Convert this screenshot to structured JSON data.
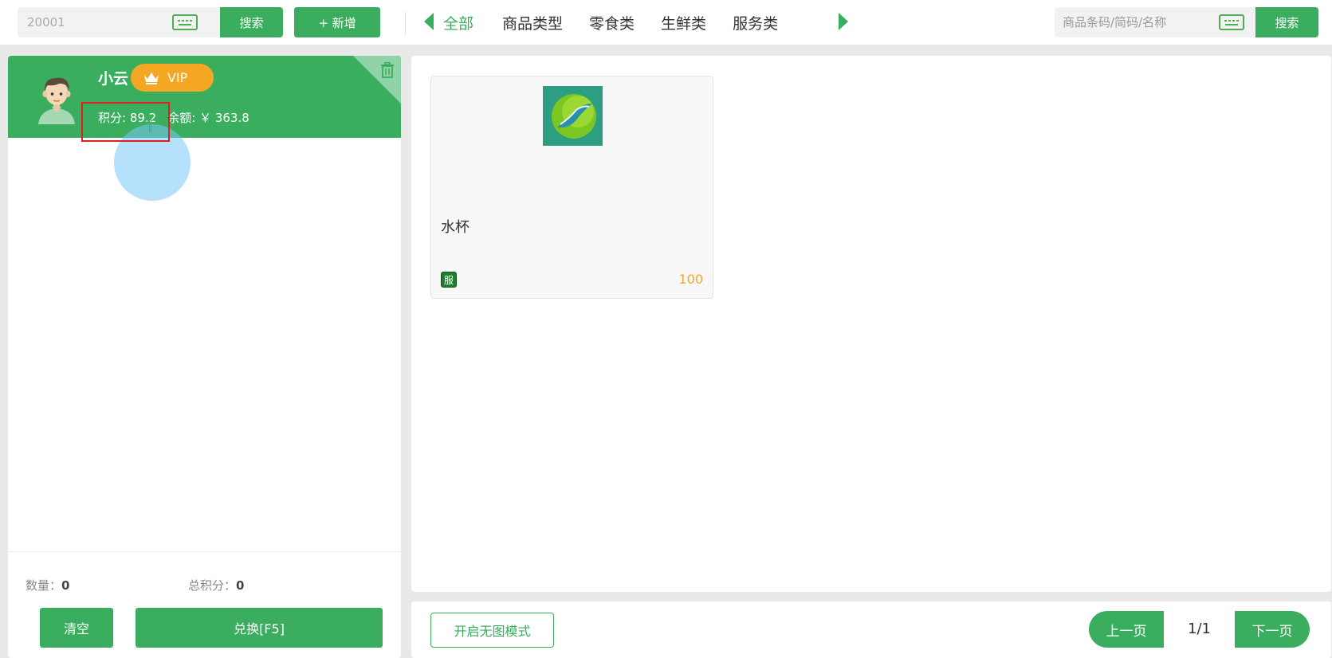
{
  "member_search": {
    "value": "20001",
    "button_label": "搜索"
  },
  "add_button_label": "+ 新增",
  "categories": [
    {
      "label": "全部",
      "active": true
    },
    {
      "label": "商品类型",
      "active": false
    },
    {
      "label": "零食类",
      "active": false
    },
    {
      "label": "生鲜类",
      "active": false
    },
    {
      "label": "服务类",
      "active": false
    }
  ],
  "goods_search": {
    "placeholder": "商品条码/简码/名称",
    "button_label": "搜索"
  },
  "member": {
    "name": "小云",
    "level": "VIP",
    "points_label": "积分: 89.2",
    "balance_label": "余额: ￥ 363.8"
  },
  "summary": {
    "quantity_label": "数量：",
    "quantity_value": "0",
    "total_points_label": "总积分：",
    "total_points_value": "0"
  },
  "actions": {
    "clear_label": "清空",
    "exchange_label": "兑换[F5]"
  },
  "products": [
    {
      "name": "水杯",
      "tag": "服",
      "points": "100"
    }
  ],
  "pager": {
    "no_image_mode_label": "开启无图模式",
    "prev_label": "上一页",
    "page_info": "1/1",
    "next_label": "下一页"
  },
  "colors": {
    "primary": "#3aad5e",
    "accent": "#f5a623"
  }
}
